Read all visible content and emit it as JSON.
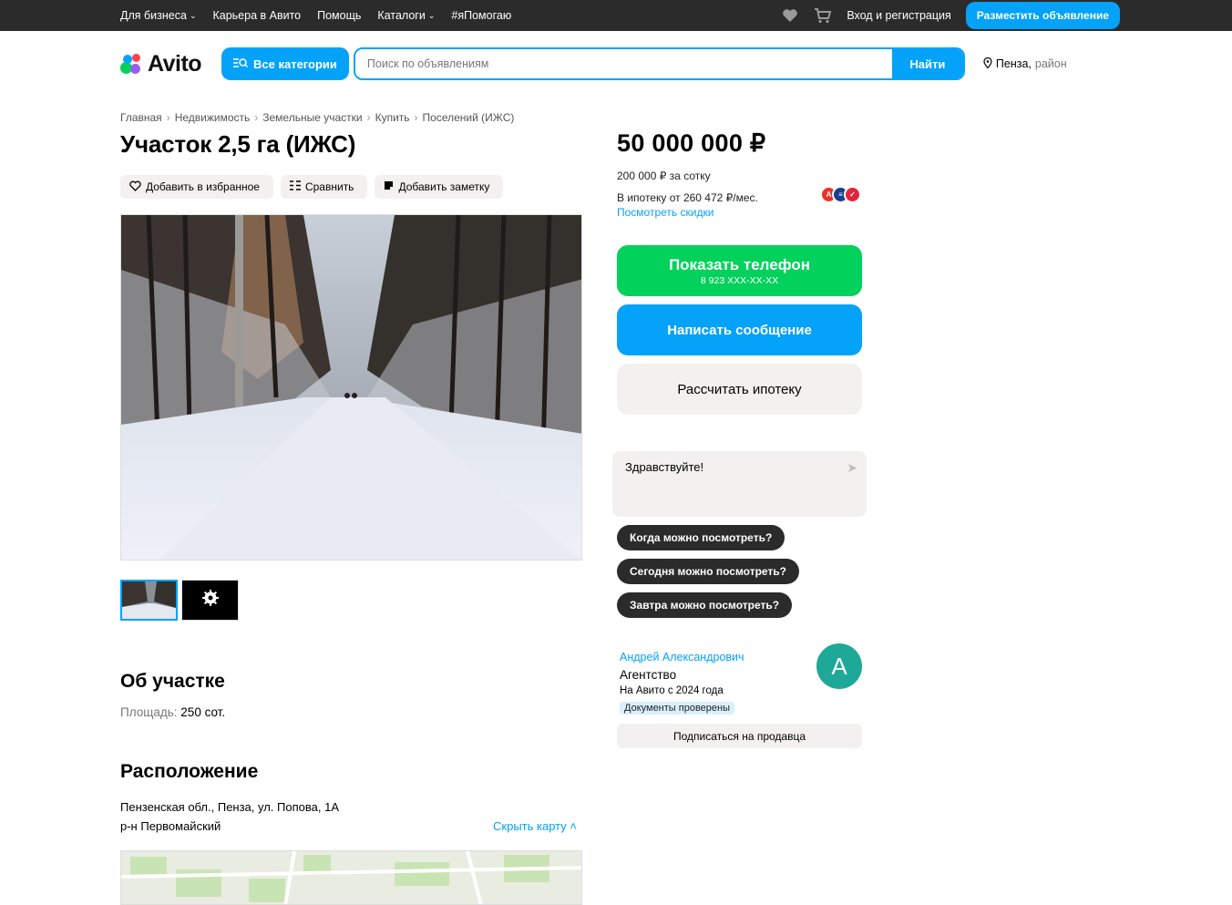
{
  "topbar": {
    "nav": [
      "Для бизнеса",
      "Карьера в Авито",
      "Помощь",
      "Каталоги",
      "#яПомогаю"
    ],
    "login": "Вход и регистрация",
    "post_button": "Разместить объявление"
  },
  "header": {
    "logo": "Avito",
    "categories_button": "Все категории",
    "search_placeholder": "Поиск по объявлениям",
    "search_button": "Найти",
    "city": "Пенза,",
    "district": "район"
  },
  "breadcrumbs": [
    "Главная",
    "Недвижимость",
    "Земельные участки",
    "Купить",
    "Поселений (ИЖС)"
  ],
  "listing": {
    "title": "Участок 2,5 га (ИЖС)",
    "actions": {
      "favorite": "Добавить в избранное",
      "compare": "Сравнить",
      "note": "Добавить заметку"
    }
  },
  "about": {
    "heading": "Об участке",
    "area_label": "Площадь:",
    "area_value": "250 сот."
  },
  "location": {
    "heading": "Расположение",
    "address": "Пензенская обл., Пенза, ул. Попова, 1А",
    "district": "р-н Первомайский",
    "hide_map": "Скрыть карту"
  },
  "sidebar": {
    "price": "50 000 000 ₽",
    "price_per": "200 000 ₽ за сотку",
    "mortgage_text": "В ипотеку от 260 472 ₽/мес.",
    "mortgage_link": "Посмотреть скидки",
    "show_phone": "Показать телефон",
    "phone_mask": "8 923 XXX-XX-XX",
    "write_message": "Написать сообщение",
    "calc_mortgage": "Рассчитать ипотеку",
    "chat_text": "Здравствуйте!",
    "quick_replies": [
      "Когда можно посмотреть?",
      "Сегодня можно посмотреть?",
      "Завтра можно посмотреть?"
    ],
    "seller": {
      "name": "Андрей Александрович",
      "type": "Агентство",
      "since": "На Авито с 2024 года",
      "badge": "Документы проверены",
      "avatar_letter": "А",
      "subscribe": "Подписаться на продавца"
    }
  },
  "colors": {
    "accent": "#04a2f9",
    "green": "#02d15c",
    "dark": "#2b2b2b",
    "light_gray": "#f2f1f0"
  }
}
